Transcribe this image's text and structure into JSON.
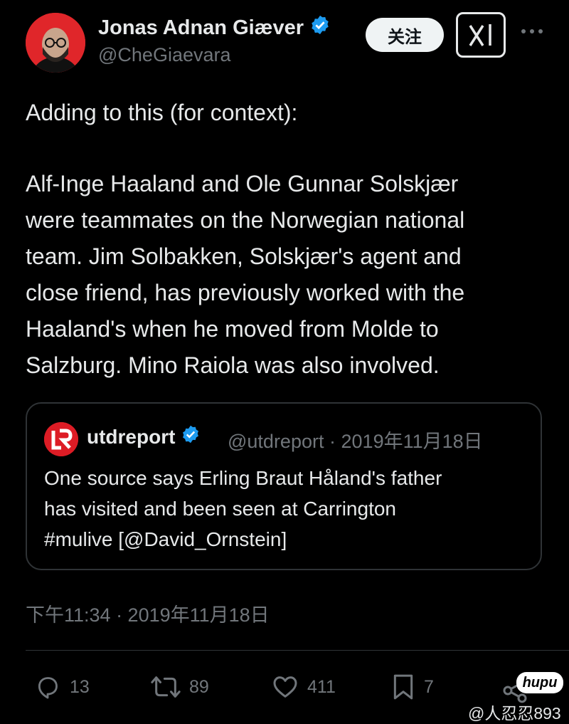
{
  "author": {
    "name": "Jonas Adnan Giæver",
    "handle": "@CheGiaevara",
    "verified": true
  },
  "header": {
    "follow_label": "关注",
    "grok_icon": "grok-icon",
    "more_icon": "more-icon"
  },
  "tweet": {
    "lines": [
      "Adding to this (for context):",
      "",
      "Alf-Inge Haaland and Ole Gunnar Solskjær",
      "were teammates on the Norwegian national",
      "team. Jim Solbakken, Solskjær's agent and",
      "close friend, has previously worked with the",
      "Haaland's when he moved from Molde to",
      "Salzburg. Mino Raiola was also involved."
    ]
  },
  "quote": {
    "name": "utdreport",
    "handle": "@utdreport",
    "date": "2019年11月18日",
    "separator": "·",
    "lines": [
      "One source says Erling Braut Håland's father",
      "has visited and been seen at Carrington",
      "#mulive [@David_Ornstein]"
    ]
  },
  "timestamp": "下午11:34 · 2019年11月18日",
  "actions": {
    "replies": "13",
    "reposts": "89",
    "likes": "411",
    "bookmarks": "7"
  },
  "watermark": {
    "badge": "hupu",
    "user": "@人忍忍893"
  },
  "colors": {
    "background": "#000000",
    "text": "#e7e9ea",
    "muted": "#71767b",
    "verified": "#1d9bf0",
    "border": "#2f3336"
  }
}
